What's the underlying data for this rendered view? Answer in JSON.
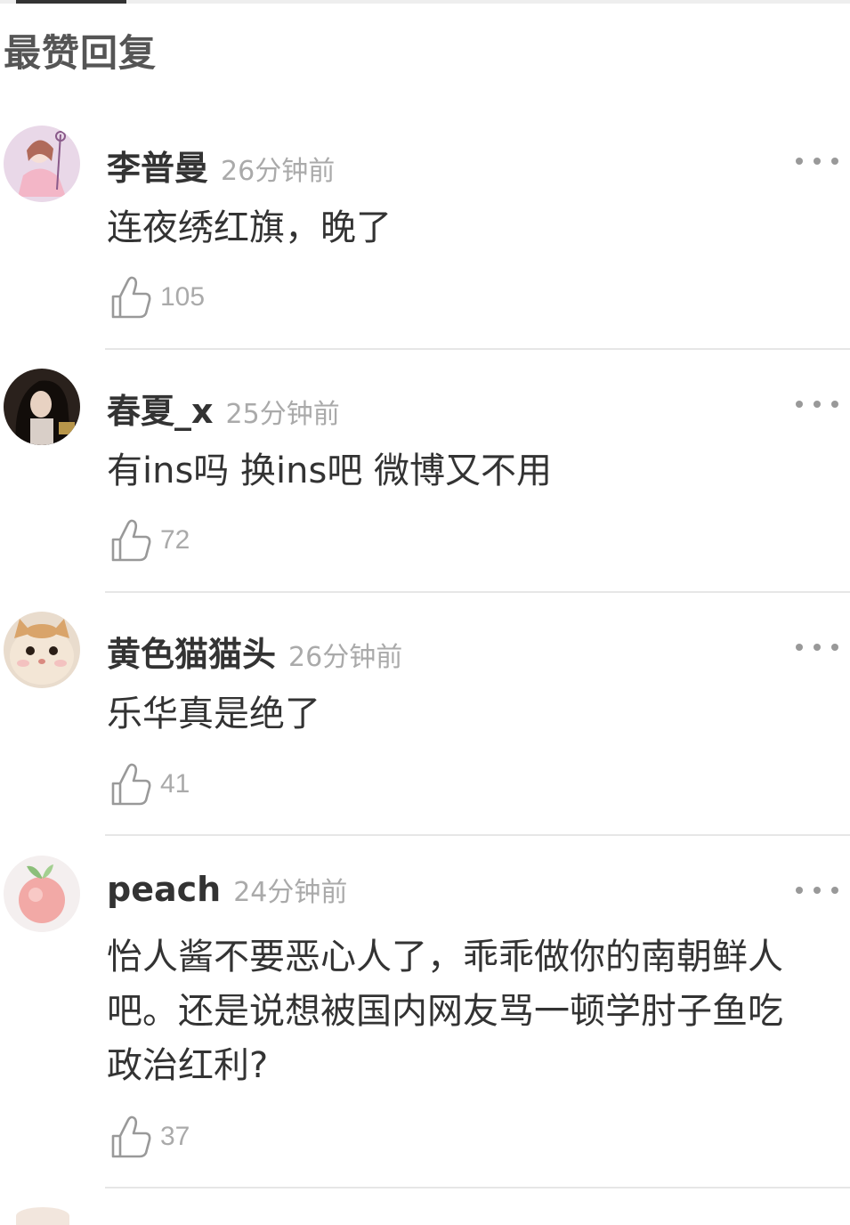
{
  "section_title": "最赞回复",
  "comments": [
    {
      "username": "李普曼",
      "timestamp": "26分钟前",
      "text": "连夜绣红旗，晚了",
      "likes": "105",
      "avatar": "anime-girl-avatar"
    },
    {
      "username": "春夏_x",
      "timestamp": "25分钟前",
      "text": "有ins吗 换ins吧 微博又不用",
      "likes": "72",
      "avatar": "dark-portrait-avatar"
    },
    {
      "username": "黄色猫猫头",
      "timestamp": "26分钟前",
      "text": "乐华真是绝了",
      "likes": "41",
      "avatar": "cat-face-avatar"
    },
    {
      "username": "peach",
      "timestamp": "24分钟前",
      "text_lines": [
        "怡人酱不要恶心人了，乖乖做你的南朝鲜人",
        "吧。还是说想被国内网友骂一顿学肘子鱼吃",
        "政治红利?"
      ],
      "likes": "37",
      "avatar": "peach-avatar"
    }
  ],
  "colors": {
    "text": "#333333",
    "muted": "#aaaaaa",
    "divider": "#e6e6e6"
  }
}
